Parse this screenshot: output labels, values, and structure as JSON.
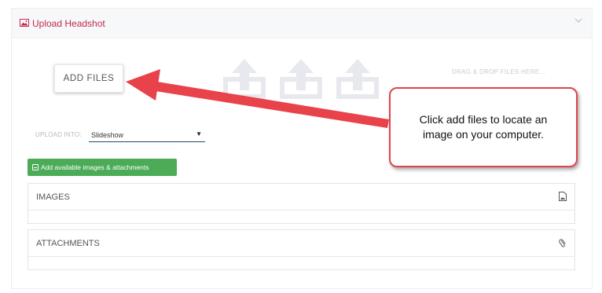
{
  "panel": {
    "title": "Upload Headshot",
    "title_icon": "image-icon",
    "toggle_icon": "chevron-down-icon",
    "accent_color": "#c4274f"
  },
  "uploader": {
    "add_files_label": "ADD FILES",
    "drop_hint": "DRAG & DROP FILES HERE...",
    "drop_icons": [
      "upload-icon",
      "upload-icon",
      "upload-icon"
    ],
    "upload_into_label": "UPLOAD INTO:",
    "upload_into_value": "Slideshow",
    "add_available_label": "Add available images & attachments",
    "add_available_icon": "minus-square-icon",
    "add_available_color": "#4bab57"
  },
  "sections": {
    "images_label": "IMAGES",
    "images_icon": "image-file-icon",
    "attachments_label": "ATTACHMENTS",
    "attachments_icon": "paperclip-icon"
  },
  "annotation": {
    "callout_text": "Click add files to locate an image on your computer.",
    "callout_color": "#e0444e",
    "arrow_color": "#e8424b"
  }
}
